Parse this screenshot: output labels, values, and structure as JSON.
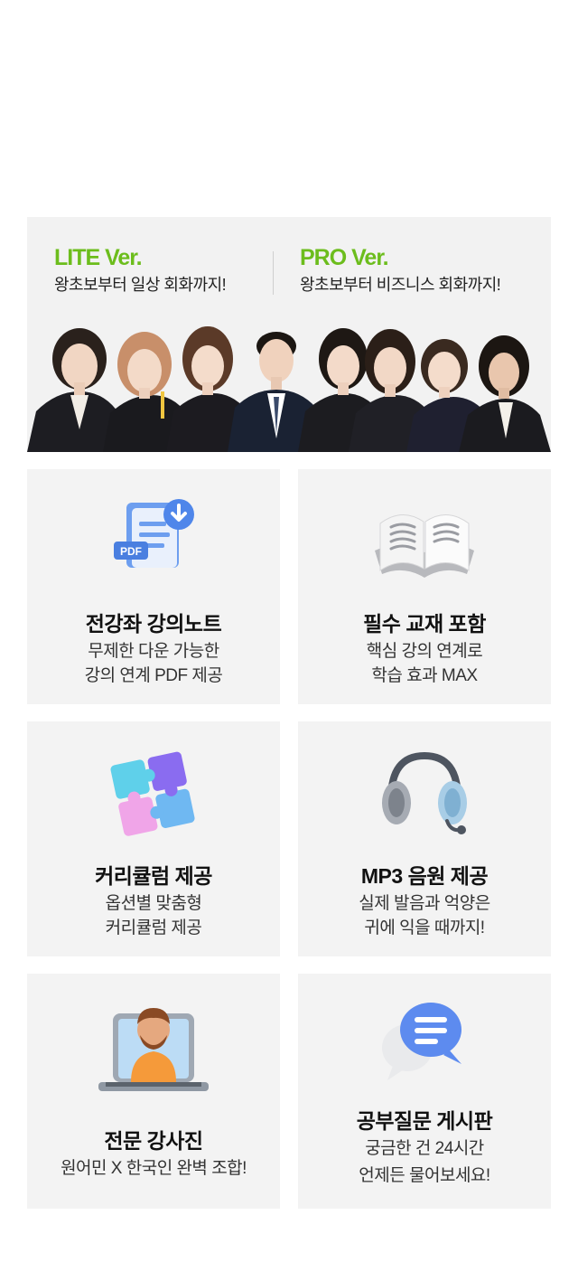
{
  "banner": {
    "lite": {
      "title": "LITE Ver.",
      "desc": "왕초보부터 일상 회화까지!"
    },
    "pro": {
      "title": "PRO Ver.",
      "desc": "왕초보부터 비즈니스 회화까지!"
    }
  },
  "colors": {
    "accent": "#6cbd1c",
    "card_bg": "#f3f3f3",
    "banner_bg": "#f2f2f2"
  },
  "features": [
    {
      "icon": "pdf-document-icon",
      "title": "전강좌 강의노트",
      "line1": "무제한 다운 가능한",
      "line2": "강의 연계 PDF 제공"
    },
    {
      "icon": "open-book-icon",
      "title": "필수 교재 포함",
      "line1": "핵심 강의 연계로",
      "line2": "학습 효과 MAX"
    },
    {
      "icon": "puzzle-icon",
      "title": "커리큘럼 제공",
      "line1": "옵션별 맞춤형",
      "line2": "커리큘럼 제공"
    },
    {
      "icon": "headset-icon",
      "title": "MP3 음원 제공",
      "line1": "실제 발음과 억양은",
      "line2": "귀에 익을 때까지!"
    },
    {
      "icon": "laptop-teacher-icon",
      "title": "전문 강사진",
      "line1": "원어민 X 한국인 완벽 조합!"
    },
    {
      "icon": "chat-bubble-icon",
      "title": "공부질문 게시판",
      "line1": "궁금한 건 24시간",
      "line2": "언제든 물어보세요!"
    }
  ]
}
